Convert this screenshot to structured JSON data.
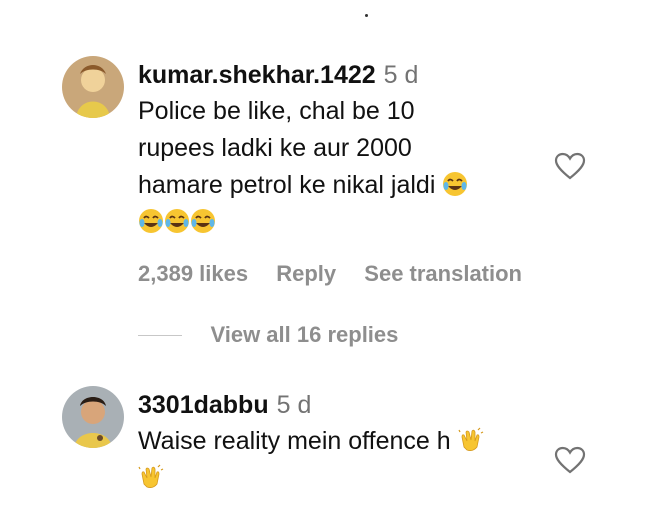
{
  "comments": [
    {
      "username": "kumar.shekhar.1422",
      "time": "5 d",
      "lines": [
        "Police be like, chal be 10",
        "rupees ladki ke aur 2000",
        "hamare petrol ke nikal jaldi"
      ],
      "emoji_icon": "tears-of-joy-emoji-icon",
      "likes": "2,389 likes",
      "reply": "Reply",
      "translate": "See translation",
      "view_replies": "View all 16 replies"
    },
    {
      "username": "3301dabbu",
      "time": "5 d",
      "lines": [
        "Waise reality mein offence h"
      ],
      "emoji_icon": "clapping-hands-emoji-icon"
    }
  ],
  "colors": {
    "text": "#111111",
    "muted": "#8e8e8e",
    "time": "#737373",
    "emoji_yellow": "#f7c531"
  }
}
